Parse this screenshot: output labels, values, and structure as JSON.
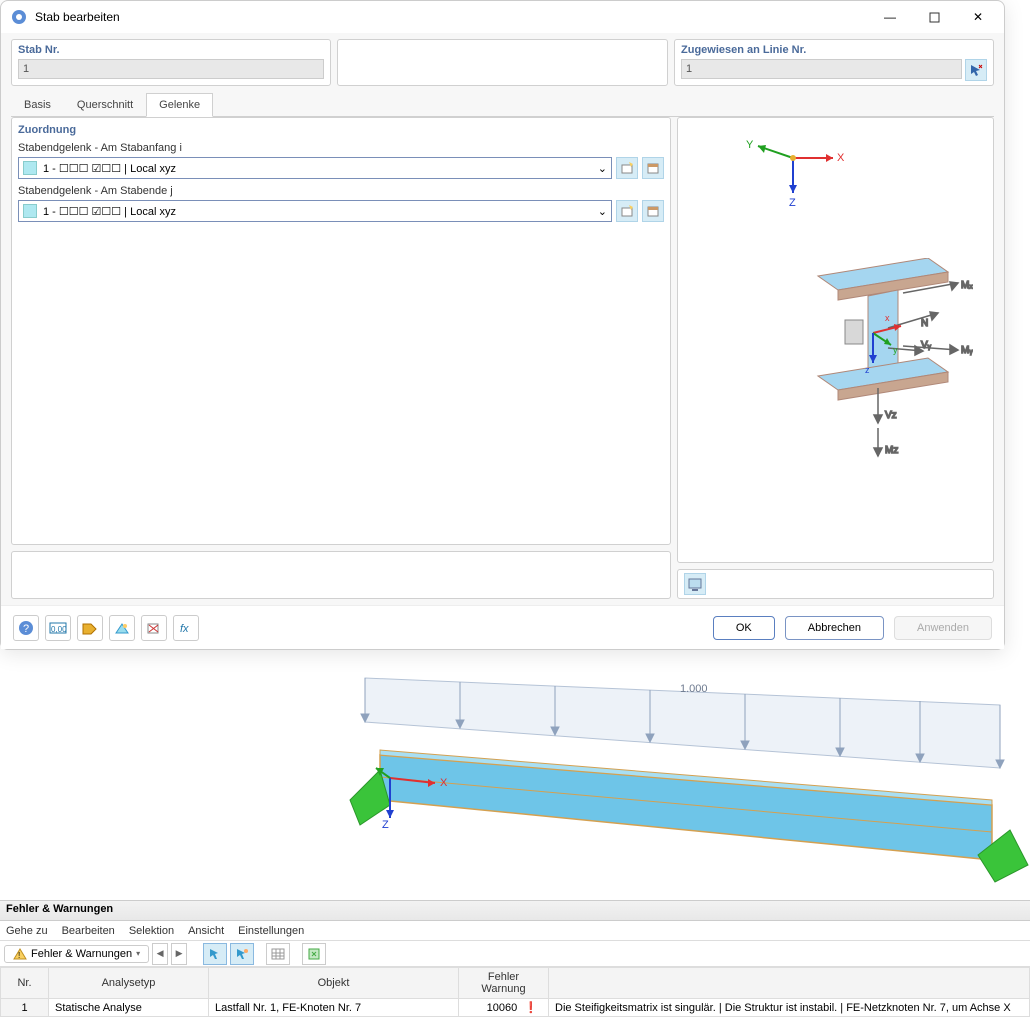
{
  "window": {
    "title": "Stab bearbeiten",
    "min": "—",
    "max": "▢",
    "close": "✕"
  },
  "fields": {
    "stabNrLabel": "Stab Nr.",
    "stabNrValue": "1",
    "zugewLabel": "Zugewiesen an Linie Nr.",
    "zugewValue": "1"
  },
  "tabs": {
    "basis": "Basis",
    "querschnitt": "Querschnitt",
    "gelenke": "Gelenke"
  },
  "zuordnung": {
    "title": "Zuordnung",
    "startLabel": "Stabendgelenk - Am Stabanfang i",
    "endLabel": "Stabendgelenk - Am Stabende j",
    "comboValue": "1 - ☐☐☐ ☑☐☐ | Local xyz"
  },
  "axes": {
    "x": "X",
    "y": "Y",
    "z": "Z"
  },
  "preview": {
    "n": "N",
    "mx": "Mₓ",
    "my": "Mᵧ",
    "mz": "Mz",
    "vy": "Vᵧ",
    "vz": "Vz",
    "x": "x",
    "y": "y",
    "z": "z"
  },
  "beamLabel": "1.000",
  "footer": {
    "ok": "OK",
    "cancel": "Abbrechen",
    "apply": "Anwenden"
  },
  "bottom": {
    "title": "Fehler & Warnungen",
    "menu": {
      "goto": "Gehe zu",
      "edit": "Bearbeiten",
      "sel": "Selektion",
      "view": "Ansicht",
      "settings": "Einstellungen"
    },
    "tab": "Fehler & Warnungen",
    "cols": {
      "nr": "Nr.",
      "atyp": "Analysetyp",
      "obj": "Objekt",
      "fw1": "Fehler",
      "fw2": "Warnung",
      "desc": ""
    },
    "row": {
      "nr": "1",
      "atyp": "Statische Analyse",
      "obj": "Lastfall Nr. 1, FE-Knoten Nr. 7",
      "code": "10060",
      "desc": "Die Steifigkeitsmatrix ist singulär. |  Die Struktur ist instabil. | FE-Netzknoten Nr. 7, um Achse X"
    }
  }
}
